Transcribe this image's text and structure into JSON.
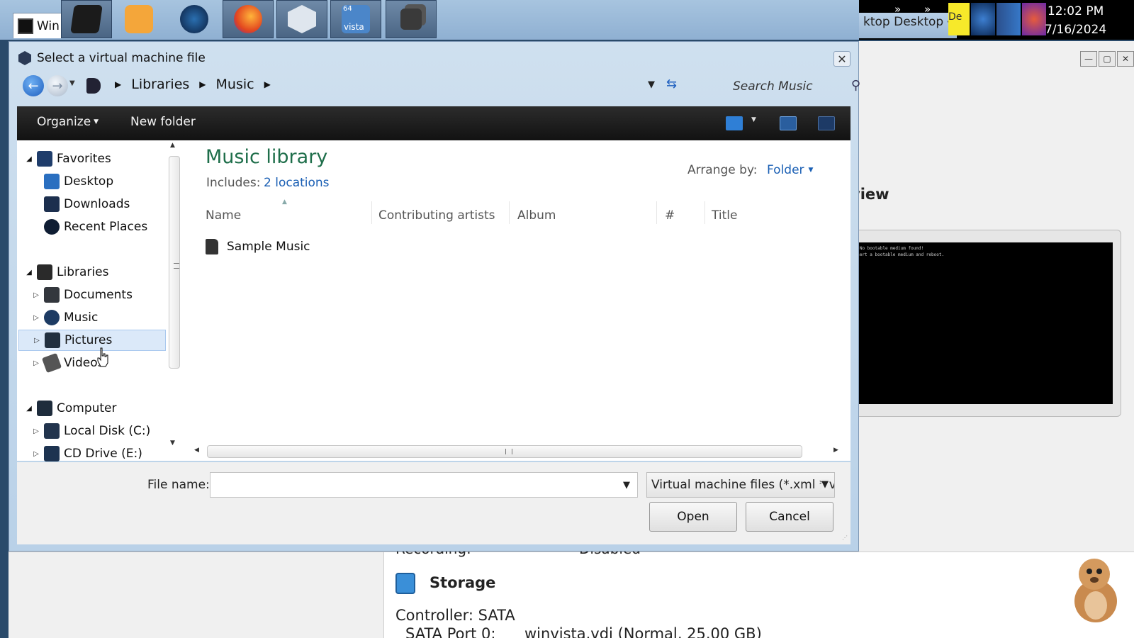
{
  "taskbar": {
    "start_label": "Win",
    "desktop_label": "ktop Desktop",
    "tray_overlap_label": "De",
    "clock_time": "12:02 PM",
    "clock_date": "7/16/2024",
    "vista_badge": "64",
    "vista_label": "vista"
  },
  "background_window": {
    "preview_heading": "view",
    "preview_console_text": "...No bootable medium found!\nInsert a bootable medium and reboot.",
    "recording_label": "Recording:",
    "recording_value": "Disabled",
    "storage_title": "Storage",
    "controller": "Controller: SATA",
    "sata_port_label": "SATA Port 0:",
    "sata_port_value": "winvista.vdi (Normal, 25.00 GB)"
  },
  "dialog": {
    "title": "Select a virtual machine file",
    "breadcrumbs": [
      "Libraries",
      "Music"
    ],
    "search_placeholder": "Search Music",
    "toolbar": {
      "organize": "Organize",
      "new_folder": "New folder"
    },
    "nav": {
      "favorites": "Favorites",
      "desktop": "Desktop",
      "downloads": "Downloads",
      "recent_places": "Recent Places",
      "libraries": "Libraries",
      "documents": "Documents",
      "music": "Music",
      "pictures": "Pictures",
      "videos": "Videos",
      "computer": "Computer",
      "local_disk": "Local Disk (C:)",
      "cd_drive": "CD Drive (E:)"
    },
    "library": {
      "title": "Music library",
      "includes_label": "Includes:",
      "locations_link": "2 locations",
      "arrange_label": "Arrange by:",
      "arrange_value": "Folder"
    },
    "columns": [
      "Name",
      "Contributing artists",
      "Album",
      "#",
      "Title"
    ],
    "files": [
      {
        "name": "Sample Music"
      }
    ],
    "file_name_label": "File name:",
    "file_name_value": "",
    "file_type": "Virtual machine files (*.xml *.vbox)",
    "open_button": "Open",
    "cancel_button": "Cancel"
  }
}
